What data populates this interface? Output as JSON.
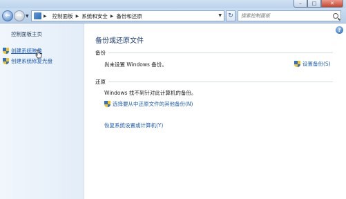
{
  "window": {
    "minimize": "–",
    "maximize": "□",
    "close": "✕"
  },
  "nav": {
    "breadcrumbs": [
      "控制面板",
      "系统和安全",
      "备份和还原"
    ],
    "search_placeholder": "搜索控制面板"
  },
  "sidebar": {
    "home": "控制面板主页",
    "links": [
      "创建系统映像",
      "创建系统修复光盘"
    ]
  },
  "main": {
    "title": "备份或还原文件",
    "backup": {
      "heading": "备份",
      "status": "尚未设置 Windows 备份。",
      "setup_link": "设置备份(S)"
    },
    "restore": {
      "heading": "还原",
      "status": "Windows 找不到针对此计算机的备份。",
      "select_link": "选择要从中还原文件的其他备份(N)",
      "recover_link": "恢复系统设置或计算机(Y)"
    }
  }
}
